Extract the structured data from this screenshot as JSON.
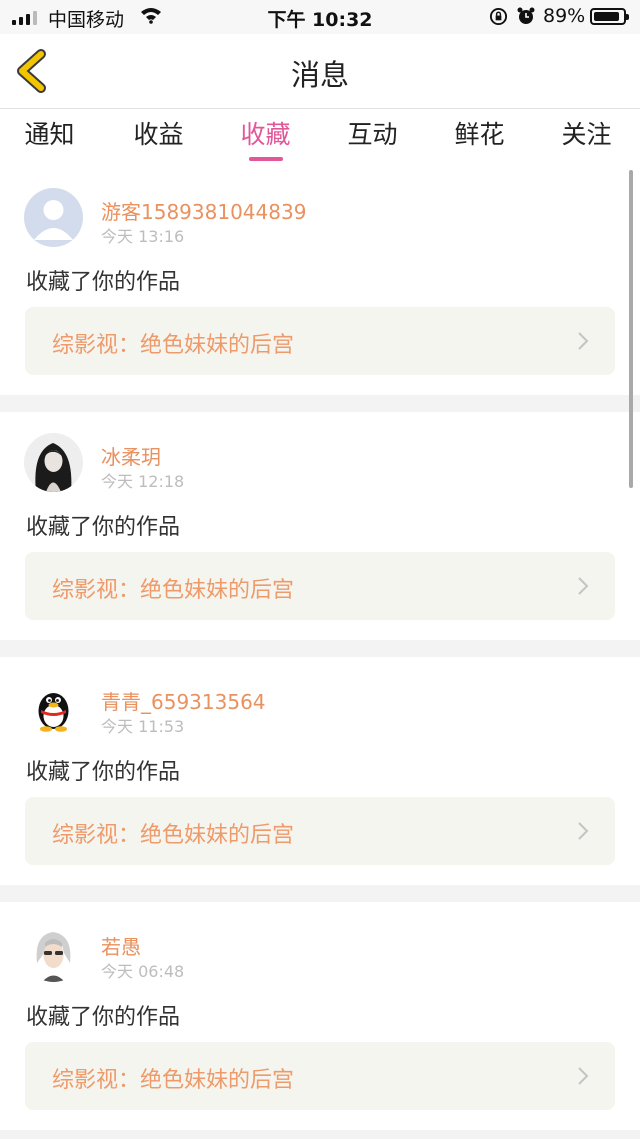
{
  "status_bar": {
    "carrier": "中国移动",
    "time": "下午 10:32",
    "battery_percent": "89%",
    "battery_level": 0.89,
    "icons": [
      "signal-icon",
      "wifi-icon",
      "rotation-lock-icon",
      "alarm-icon",
      "battery-icon"
    ]
  },
  "nav": {
    "title": "消息",
    "back_icon": "chevron-left-icon"
  },
  "tabs": [
    {
      "label": "通知"
    },
    {
      "label": "收益"
    },
    {
      "label": "收藏"
    },
    {
      "label": "互动"
    },
    {
      "label": "鲜花"
    },
    {
      "label": "关注"
    }
  ],
  "active_tab": "收藏",
  "messages": [
    {
      "user": "游客1589381044839",
      "time": "今天 13:16",
      "action": "收藏了你的作品",
      "work": "综影视：绝色妹妹的后宫",
      "avatar": "default-avatar"
    },
    {
      "user": "冰柔玥",
      "time": "今天 12:18",
      "action": "收藏了你的作品",
      "work": "综影视：绝色妹妹的后宫",
      "avatar": "girl-avatar"
    },
    {
      "user": "青青_659313564",
      "time": "今天 11:53",
      "action": "收藏了你的作品",
      "work": "综影视：绝色妹妹的后宫",
      "avatar": "penguin-avatar"
    },
    {
      "user": "若愚",
      "time": "今天 06:48",
      "action": "收藏了你的作品",
      "work": "综影视：绝色妹妹的后宫",
      "avatar": "anime-avatar"
    }
  ],
  "colors": {
    "accent_pink": "#e2579a",
    "username_orange": "#e9915f",
    "back_yellow": "#f2c500",
    "card_link_bg": "#f5f5ef"
  }
}
